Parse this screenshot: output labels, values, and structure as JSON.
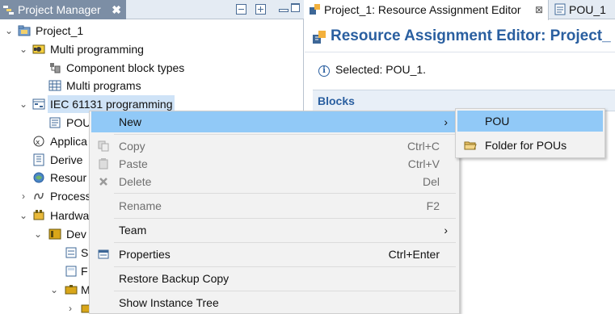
{
  "project_manager": {
    "tab_title": "Project Manager",
    "close_glyph": "✖",
    "tree": [
      {
        "label": "Project_1",
        "icon": "project-icon",
        "expanded": true
      },
      {
        "label": "Multi programming",
        "icon": "multi-programming-icon",
        "expanded": true
      },
      {
        "label": "Component block types",
        "icon": "component-block-types-icon"
      },
      {
        "label": "Multi programs",
        "icon": "multi-programs-icon"
      },
      {
        "label": "IEC 61131 programming",
        "icon": "iec-programming-icon",
        "expanded": true,
        "selected": true
      },
      {
        "label": "POU",
        "icon": "pou-icon"
      },
      {
        "label": "Applica",
        "icon": "application-icon"
      },
      {
        "label": "Derive",
        "icon": "derived-types-icon"
      },
      {
        "label": "Resour",
        "icon": "resource-icon"
      },
      {
        "label": "Process",
        "icon": "process-icon",
        "expanded": false
      },
      {
        "label": "Hardwa",
        "icon": "hardware-icon",
        "expanded": true
      },
      {
        "label": "Dev",
        "icon": "device-icon",
        "expanded": true
      },
      {
        "label": "S",
        "icon": "settings-icon"
      },
      {
        "label": "F",
        "icon": "file-icon"
      },
      {
        "label": "M",
        "icon": "module-icon",
        "expanded": true
      }
    ]
  },
  "editor": {
    "tab_active": "Project_1: Resource Assignment Editor",
    "tab_close_glyph": "⊠",
    "tab_second": "POU_1",
    "title": "Resource Assignment Editor: Project_",
    "selected_text": "Selected: POU_1.",
    "blocks_header": "Blocks"
  },
  "context_menu": {
    "items": [
      {
        "label": "New",
        "arrow": "›",
        "highlighted": true,
        "enabled": true
      },
      {
        "label": "Copy",
        "shortcut": "Ctrl+C",
        "icon": "copy-icon",
        "enabled": false
      },
      {
        "label": "Paste",
        "shortcut": "Ctrl+V",
        "icon": "paste-icon",
        "enabled": false
      },
      {
        "label": "Delete",
        "shortcut": "Del",
        "icon": "delete-icon",
        "enabled": false
      },
      {
        "label": "Rename",
        "shortcut": "F2",
        "enabled": false
      },
      {
        "label": "Team",
        "arrow": "›",
        "enabled": true
      },
      {
        "label": "Properties",
        "shortcut": "Ctrl+Enter",
        "icon": "properties-icon",
        "enabled": true
      },
      {
        "label": "Restore Backup Copy",
        "enabled": true
      },
      {
        "label": "Show Instance Tree",
        "enabled": true
      }
    ]
  },
  "submenu": {
    "items": [
      {
        "label": "POU",
        "highlighted": true
      },
      {
        "label": "Folder for POUs",
        "icon": "folder-icon"
      }
    ]
  },
  "colors": {
    "highlight": "#91c9f7",
    "tab_active_bg": "#7c8ea5",
    "title_blue": "#2a5fa0",
    "tree_selection": "#cfe3f7"
  }
}
